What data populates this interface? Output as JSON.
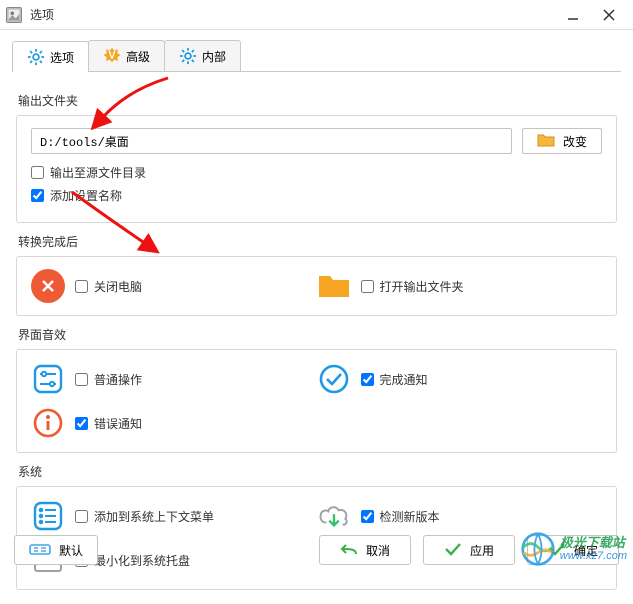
{
  "window": {
    "title": "选项"
  },
  "tabs": {
    "options": "选项",
    "advanced": "高级",
    "internal": "内部"
  },
  "sections": {
    "output_folder": "输出文件夹",
    "after_convert": "转换完成后",
    "ui_sound": "界面音效",
    "system": "系统"
  },
  "output": {
    "path": "D:/tools/桌面",
    "change_btn": "改变",
    "to_source_dir": "输出至源文件目录",
    "add_preset_name": "添加设置名称"
  },
  "after": {
    "shutdown": "关闭电脑",
    "open_output": "打开输出文件夹"
  },
  "sound": {
    "normal_op": "普通操作",
    "complete_notice": "完成通知",
    "error_notice": "错误通知"
  },
  "system": {
    "context_menu": "添加到系统上下文菜单",
    "check_update": "检测新版本",
    "min_to_tray": "最小化到系统托盘"
  },
  "buttons": {
    "defaults": "默认",
    "cancel": "取消",
    "apply": "应用",
    "ok": "确定"
  },
  "watermark": {
    "cn": "极光下载站",
    "url": "www.xz7.com"
  }
}
